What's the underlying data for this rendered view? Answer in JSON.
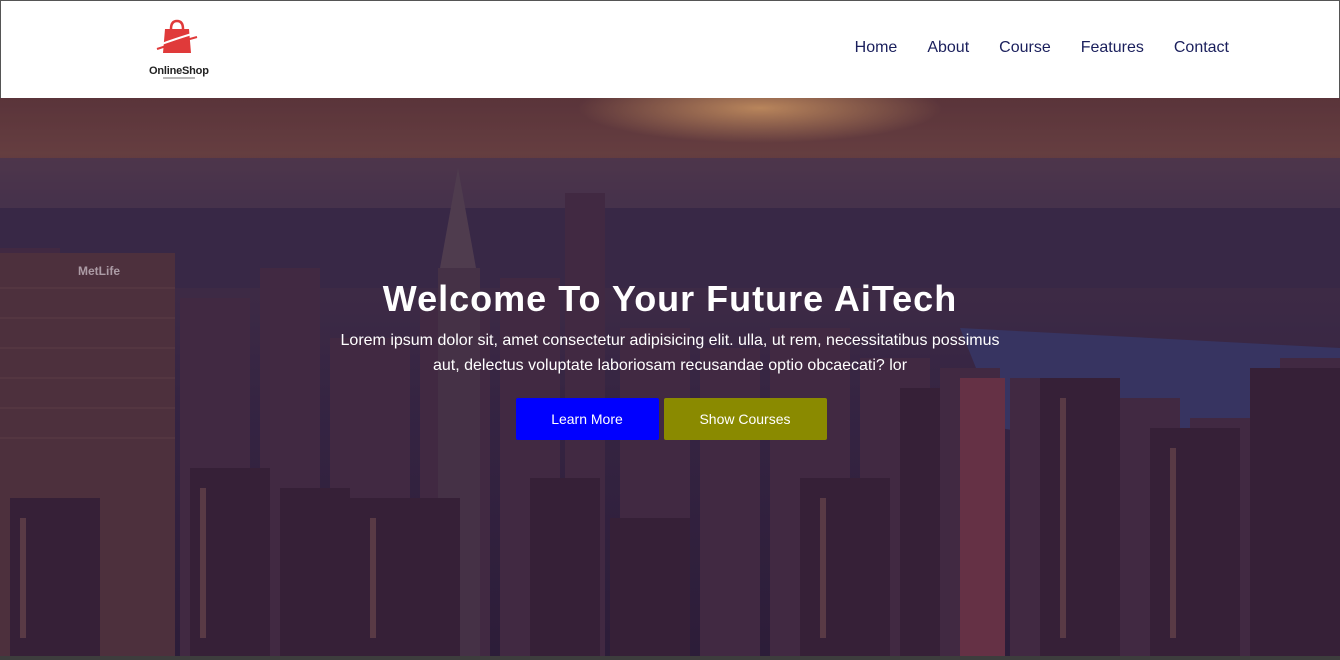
{
  "brand": {
    "name": "OnlineShop",
    "icon": "shopping-bag-icon",
    "color": "#e03a3a"
  },
  "nav": {
    "items": [
      {
        "label": "Home"
      },
      {
        "label": "About"
      },
      {
        "label": "Course"
      },
      {
        "label": "Features"
      },
      {
        "label": "Contact"
      }
    ]
  },
  "hero": {
    "title": "Welcome To Your Future AiTech",
    "text": "Lorem ipsum dolor sit, amet consectetur adipisicing elit. ulla, ut rem, necessitatibus possimus aut, delectus voluptate laboriosam recusandae optio obcaecati? lor",
    "background": "city-skyline-photo",
    "buttons": {
      "learn_more": {
        "label": "Learn More",
        "color": "#0000ff"
      },
      "show_courses": {
        "label": "Show Courses",
        "color": "#8a8a00"
      }
    }
  },
  "colors": {
    "nav_text": "#1a1f5c",
    "navbar_bg": "#ffffff"
  }
}
